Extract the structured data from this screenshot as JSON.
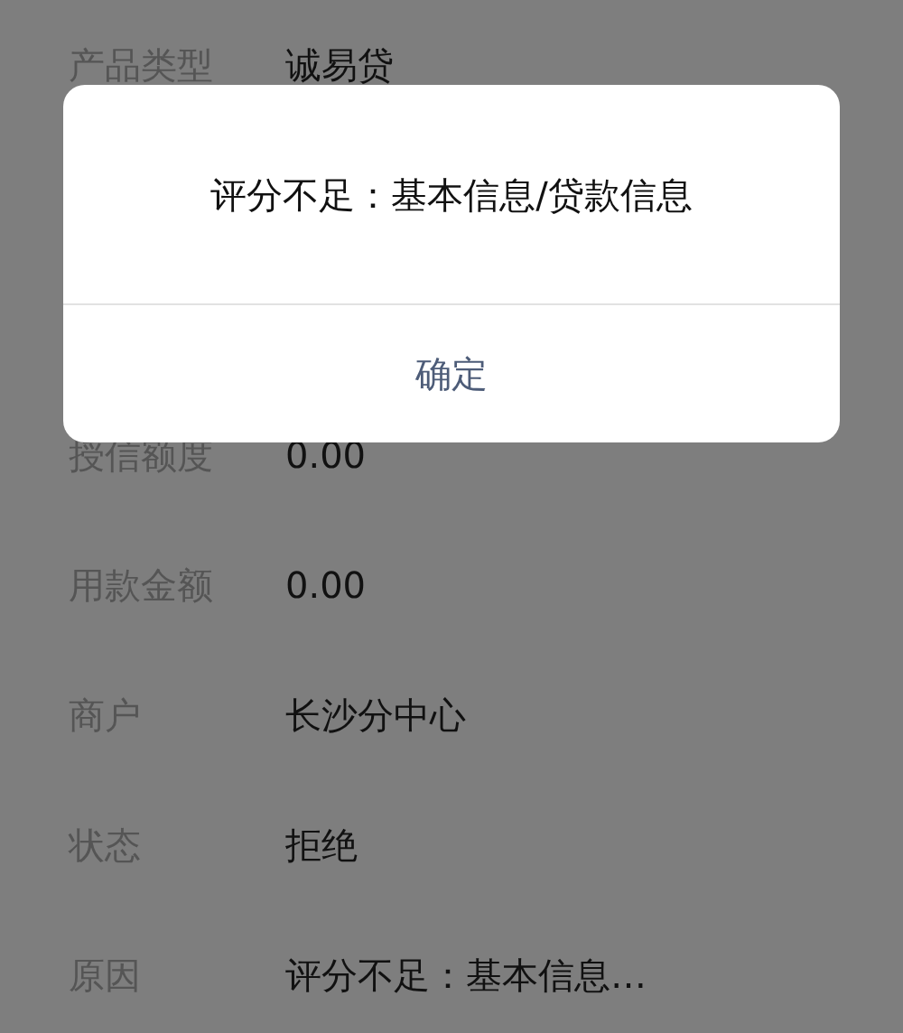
{
  "rows_above": [
    {
      "label": "产品类型",
      "value": "诚易贷"
    }
  ],
  "rows_below": [
    {
      "label": "授信额度",
      "value": "0.00"
    },
    {
      "label": "用款金额",
      "value": "0.00"
    },
    {
      "label": "商户",
      "value": "长沙分中心"
    },
    {
      "label": "状态",
      "value": "拒绝"
    },
    {
      "label": "原因",
      "value": "评分不足：基本信息…"
    }
  ],
  "dialog": {
    "message": "评分不足：基本信息/贷款信息",
    "button": "确定"
  }
}
